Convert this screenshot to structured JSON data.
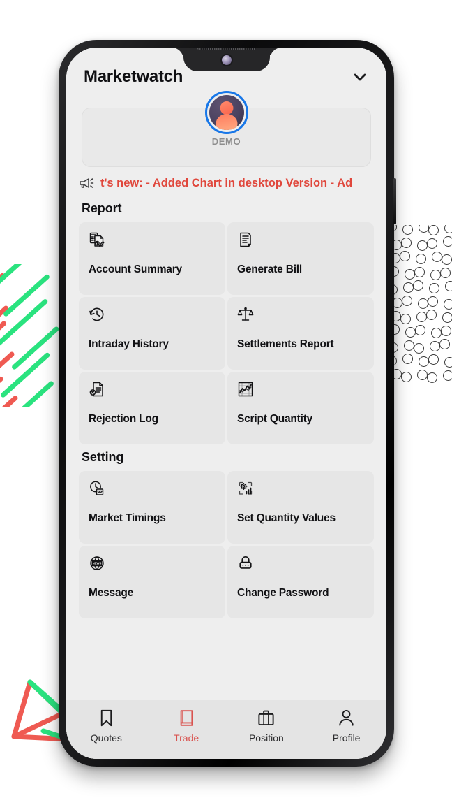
{
  "app": {
    "title": "Marketwatch",
    "header_chevron_icon": "chevron-down-icon"
  },
  "account": {
    "avatar_icon": "user-avatar-icon",
    "label": "DEMO"
  },
  "marquee": {
    "icon": "megaphone-icon",
    "text": "t's new:  - Added Chart in desktop Version   - Ad",
    "color": "#e0473c"
  },
  "sections": [
    {
      "title": "Report",
      "tiles": [
        {
          "label": "Account Summary",
          "icon": "document-calculator-edit-icon"
        },
        {
          "label": "Generate Bill",
          "icon": "document-lines-icon"
        },
        {
          "label": "Intraday History",
          "icon": "clock-history-icon"
        },
        {
          "label": "Settlements Report",
          "icon": "balance-scales-icon"
        },
        {
          "label": "Rejection Log",
          "icon": "document-x-circle-icon"
        },
        {
          "label": "Script Quantity",
          "icon": "line-chart-icon"
        }
      ]
    },
    {
      "title": "Setting",
      "tiles": [
        {
          "label": "Market Timings",
          "icon": "clock-calendar-icon"
        },
        {
          "label": "Set Quantity Values",
          "icon": "gear-bar-chart-icon"
        },
        {
          "label": "Message",
          "icon": "news-globe-icon"
        },
        {
          "label": "Change Password",
          "icon": "padlock-dots-icon"
        }
      ]
    }
  ],
  "bottom_nav": {
    "active_color": "#d9534f",
    "items": [
      {
        "label": "Quotes",
        "icon": "bookmark-icon",
        "active": false
      },
      {
        "label": "Trade",
        "icon": "book-icon",
        "active": true
      },
      {
        "label": "Position",
        "icon": "briefcase-icon",
        "active": false
      },
      {
        "label": "Profile",
        "icon": "person-icon",
        "active": false
      }
    ]
  },
  "decoration": {
    "stripe_colors": [
      "#ef5a52",
      "#2ae37f"
    ],
    "dot_color": "#3a3a3a",
    "pyramid_colors": [
      "#ef5a52",
      "#2ae37f"
    ]
  }
}
